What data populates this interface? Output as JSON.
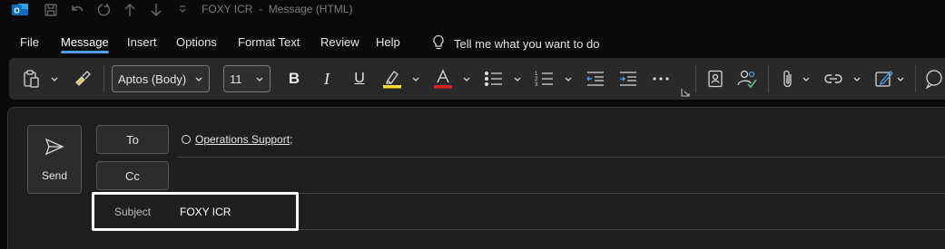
{
  "window": {
    "title": "FOXY ICR  -  Message (HTML)"
  },
  "quick_access": [
    {
      "name": "save-icon"
    },
    {
      "name": "undo-icon"
    },
    {
      "name": "redo-icon"
    },
    {
      "name": "previous-item-icon"
    },
    {
      "name": "next-item-icon"
    },
    {
      "name": "customize-quick-access-icon"
    }
  ],
  "menu": {
    "tabs": [
      "File",
      "Message",
      "Insert",
      "Options",
      "Format Text",
      "Review",
      "Help"
    ],
    "active": "Message",
    "tell_me": "Tell me what you want to do"
  },
  "ribbon": {
    "font_name": "Aptos (Body)",
    "font_size": "11",
    "bold": "B",
    "italic": "I",
    "underline": "U",
    "highlight_color": "#f5e12b",
    "font_color": "#e02020"
  },
  "compose": {
    "send_label": "Send",
    "to_label": "To",
    "cc_label": "Cc",
    "recipient": "Operations Support",
    "recipient_suffix": ";",
    "subject_label": "Subject",
    "subject_value": "FOXY ICR"
  },
  "colors": {
    "accent": "#4f9ded",
    "outlook_blue": "#0f6cbd"
  }
}
